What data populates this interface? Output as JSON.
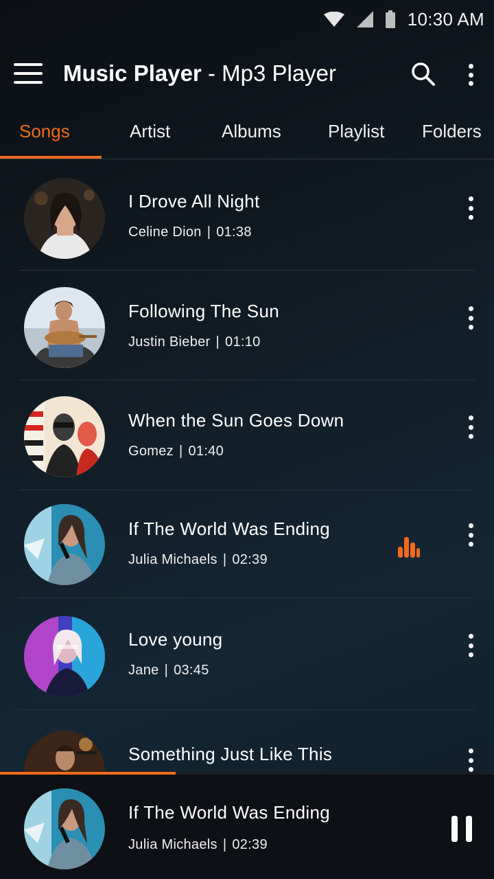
{
  "status_bar": {
    "time": "10:30 AM",
    "icons": [
      "wifi-icon",
      "signal-icon",
      "battery-icon"
    ]
  },
  "app_bar": {
    "title_bold": "Music Player",
    "title_rest": " - Mp3 Player",
    "icons": [
      "menu-icon",
      "search-icon",
      "more-vert-icon"
    ]
  },
  "tabs": [
    {
      "label": "Songs",
      "active": true
    },
    {
      "label": "Artist",
      "active": false
    },
    {
      "label": "Albums",
      "active": false
    },
    {
      "label": "Playlist",
      "active": false
    },
    {
      "label": "Folders",
      "active": false
    }
  ],
  "songs": [
    {
      "title": "I Drove All Night",
      "artist": "Celine Dion",
      "duration": "01:38",
      "playing": false
    },
    {
      "title": "Following The Sun",
      "artist": "Justin Bieber",
      "duration": "01:10",
      "playing": false
    },
    {
      "title": "When the Sun Goes Down",
      "artist": "Gomez",
      "duration": "01:40",
      "playing": false
    },
    {
      "title": "If The World Was Ending",
      "artist": "Julia Michaels",
      "duration": "02:39",
      "playing": true
    },
    {
      "title": "Love young",
      "artist": "Jane",
      "duration": "03:45",
      "playing": false
    },
    {
      "title": "Something Just Like This",
      "artist": "",
      "duration": "",
      "playing": false
    }
  ],
  "now_playing": {
    "title": "If The World Was Ending",
    "artist": "Julia Michaels",
    "duration": "02:39",
    "progress": 0.355,
    "icon": "pause-icon"
  },
  "colors": {
    "accent": "#f26a1b"
  }
}
